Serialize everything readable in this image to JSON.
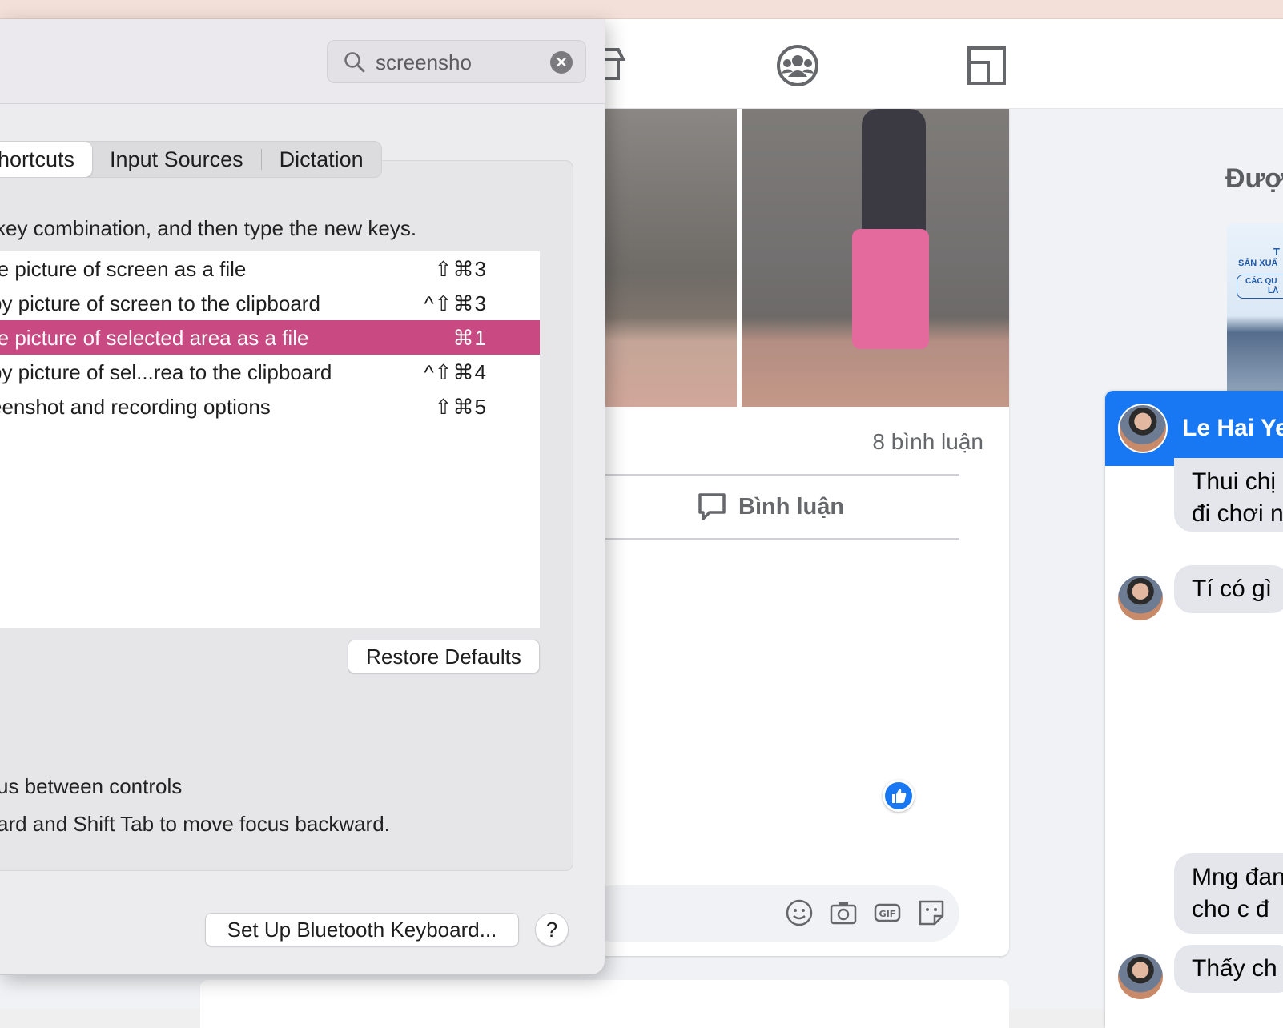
{
  "prefs": {
    "search": {
      "value": "screensho",
      "placeholder": "Search"
    },
    "tabs": [
      {
        "label": "hortcuts",
        "active": true
      },
      {
        "label": "Input Sources",
        "active": false
      },
      {
        "label": "Dictation",
        "active": false
      }
    ],
    "instruction": "key combination, and then type the new keys.",
    "shortcuts": [
      {
        "name": "re picture of screen as a file",
        "keys": "⇧⌘3",
        "selected": false
      },
      {
        "name": "py picture of screen to the clipboard",
        "keys": "^⇧⌘3",
        "selected": false
      },
      {
        "name": "re picture of selected area as a file",
        "keys": "⌘1",
        "selected": true
      },
      {
        "name": "py picture of sel...rea to the clipboard",
        "keys": "^⇧⌘4",
        "selected": false
      },
      {
        "name": "eenshot and recording options",
        "keys": "⇧⌘5",
        "selected": false
      }
    ],
    "restore_defaults": "Restore Defaults",
    "keyboard_nav_label": "us between controls",
    "keyboard_nav_hint": "ard and Shift Tab to move focus backward.",
    "bluetooth_button": "Set Up Bluetooth Keyboard...",
    "help_button": "?",
    "selection_color": "#c94a82"
  },
  "facebook": {
    "comments_count": "8 bình luận",
    "comment_button": "Bình luận",
    "sponsored_title": "Đượ",
    "ad_text_1": "T",
    "ad_text_2": "SẢN XUẤ",
    "ad_text_3": "CÁC QU",
    "ad_text_4": "LÀ",
    "accent_color": "#1877f2"
  },
  "chat": {
    "name": "Le Hai Ye",
    "messages": [
      {
        "lines": [
          "Thui chị",
          "đi chơi n"
        ]
      },
      {
        "lines": [
          "Tí có gì"
        ]
      },
      {
        "lines": [
          "Mng đan",
          "cho c đ"
        ]
      },
      {
        "lines": [
          "Thấy ch"
        ]
      }
    ]
  }
}
